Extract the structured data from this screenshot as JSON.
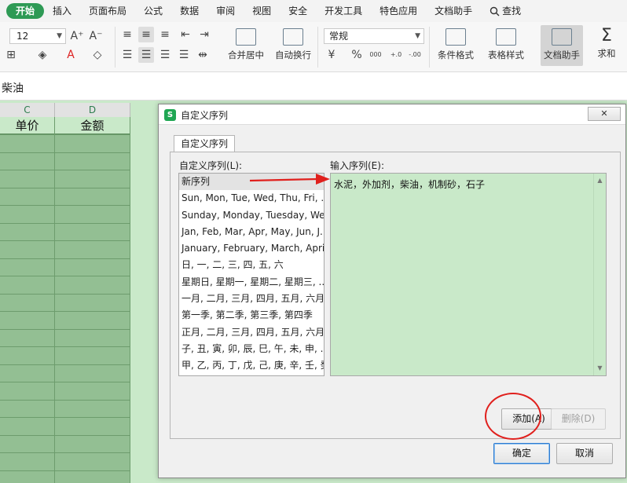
{
  "menu": {
    "items": [
      "开始",
      "插入",
      "页面布局",
      "公式",
      "数据",
      "审阅",
      "视图",
      "安全",
      "开发工具",
      "特色应用",
      "文档助手"
    ],
    "search_label": "查找"
  },
  "ribbon": {
    "font_size": "12",
    "number_format": "常规",
    "merge_center": "合并居中",
    "auto_wrap": "自动换行",
    "conditional_format": "条件格式",
    "table_style": "表格样式",
    "doc_assistant": "文档助手",
    "sum": "求和",
    "font_grow": "A⁺",
    "font_shrink": "A⁻",
    "font_color_glyph": "A",
    "percent_glyph": "%",
    "thousands_glyph": "000",
    "inc_decimal_glyph": "+.0",
    "dec_decimal_glyph": "-.00",
    "sum_glyph": "Σ"
  },
  "formula_bar": {
    "value": "柴油"
  },
  "sheet": {
    "columns": [
      {
        "letter": "C",
        "header": "单价"
      },
      {
        "letter": "D",
        "header": "金额"
      }
    ]
  },
  "dialog": {
    "title": "自定义序列",
    "close_label": "✕",
    "tab_label": "自定义序列",
    "list_label": "自定义序列(L):",
    "input_label": "输入序列(E):",
    "input_value": "水泥，外加剂，柴油，机制砂，石子",
    "list_items": [
      "新序列",
      "Sun, Mon, Tue, Wed, Thu, Fri, ...",
      "Sunday, Monday, Tuesday, We...",
      "Jan, Feb, Mar, Apr, May, Jun, J...",
      "January, February, March, Apri...",
      "日, 一, 二, 三, 四, 五, 六",
      "星期日, 星期一, 星期二, 星期三, ...",
      "一月, 二月, 三月, 四月, 五月, 六月...",
      "第一季, 第二季, 第三季, 第四季",
      "正月, 二月, 三月, 四月, 五月, 六月...",
      "子, 丑, 寅, 卯, 辰, 巳, 午, 未, 申, ...",
      "甲, 乙, 丙, 丁, 戊, 己, 庚, 辛, 壬, 癸"
    ],
    "add_button": "添加(A)",
    "delete_button": "删除(D)",
    "ok_button": "确定",
    "cancel_button": "取消"
  },
  "colors": {
    "accent": "#2e9a55",
    "sheet_fill": "#c9e9c9",
    "annotation_red": "#e0201d",
    "primary_border": "#2f7bd0"
  }
}
